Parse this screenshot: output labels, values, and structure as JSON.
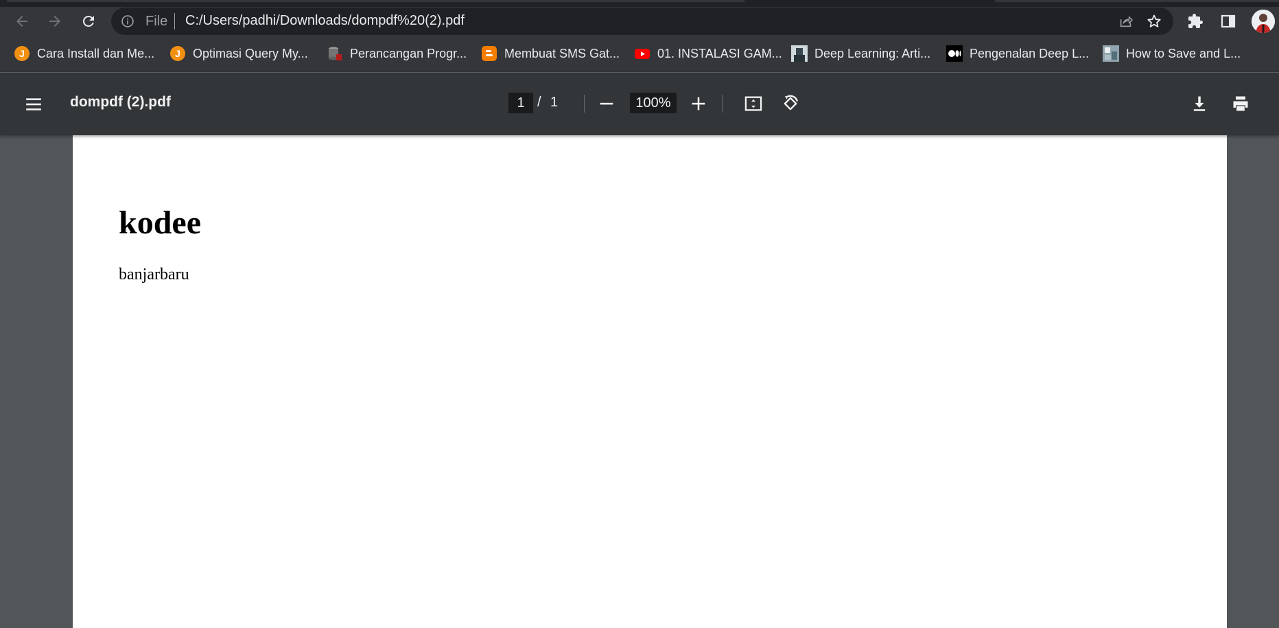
{
  "browser": {
    "omnibox": {
      "scheme_label": "File",
      "url": "C:/Users/padhi/Downloads/dompdf%20(2).pdf"
    },
    "bookmarks": [
      {
        "label": "Cara Install dan Me...",
        "icon": "orange-j-icon"
      },
      {
        "label": "Optimasi Query My...",
        "icon": "orange-j-icon"
      },
      {
        "label": "Perancangan Progr...",
        "icon": "database-icon"
      },
      {
        "label": "Membuat SMS Gat...",
        "icon": "blogger-icon"
      },
      {
        "label": "01. INSTALASI GAM...",
        "icon": "youtube-icon"
      },
      {
        "label": "Deep Learning: Arti...",
        "icon": "thumbnail-icon"
      },
      {
        "label": "Pengenalan Deep L...",
        "icon": "medium-icon"
      },
      {
        "label": "How to Save and L...",
        "icon": "thumbnail-icon"
      }
    ]
  },
  "pdf_viewer": {
    "title": "dompdf (2).pdf",
    "current_page": "1",
    "page_separator": "/",
    "total_pages": "1",
    "zoom": "100%"
  },
  "document": {
    "heading": "kodee",
    "text": "banjarbaru"
  },
  "colors": {
    "chrome_frame": "#202124",
    "chrome_toolbar": "#35363a",
    "pdf_toolbar": "#323639",
    "viewer_background": "#525659",
    "youtube_red": "#ff0000",
    "blogger_orange": "#f57d00"
  }
}
